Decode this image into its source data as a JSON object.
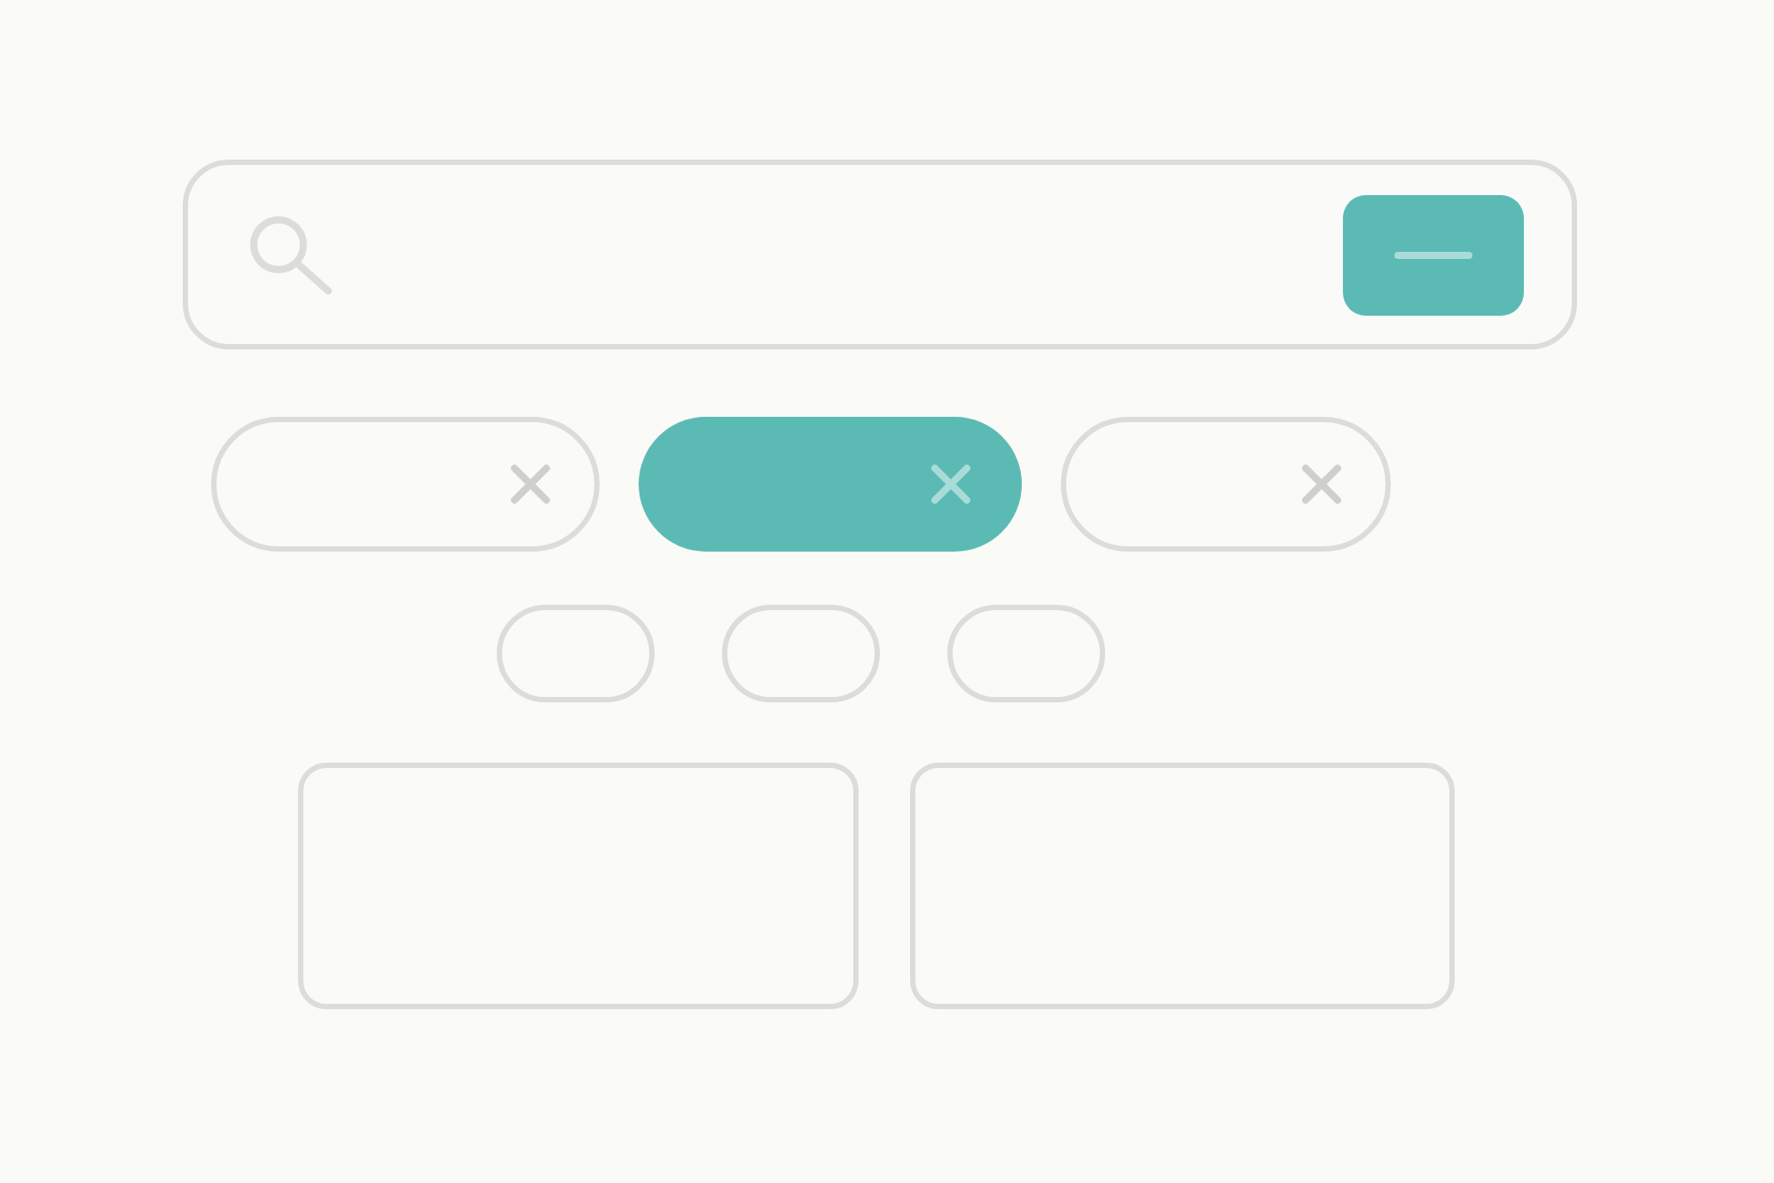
{
  "search_bar": {
    "kind": "search"
  },
  "chips": [
    {
      "selected": false
    },
    {
      "selected": true
    },
    {
      "selected": false
    }
  ],
  "pills": [
    {
      "selected": false
    },
    {
      "selected": false
    },
    {
      "selected": false
    }
  ],
  "cards": [
    {
      "kind": "card"
    },
    {
      "kind": "card"
    }
  ]
}
